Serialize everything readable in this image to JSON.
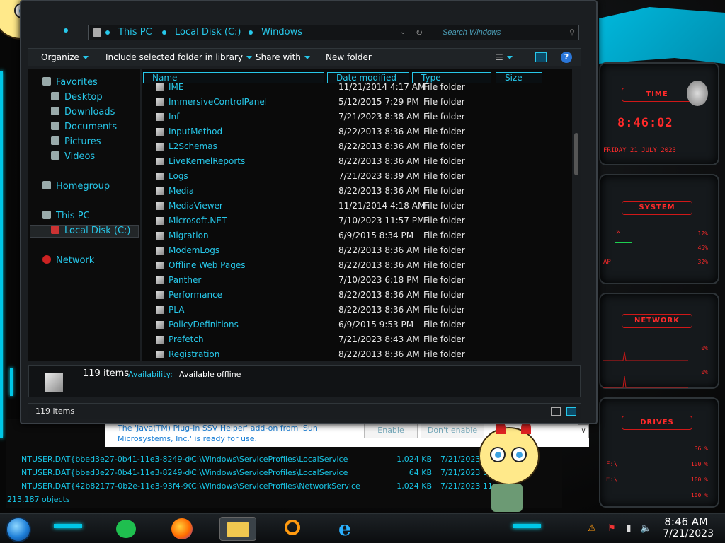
{
  "explorer": {
    "breadcrumb": [
      "This PC",
      "Local Disk (C:)",
      "Windows"
    ],
    "search_placeholder": "Search Windows",
    "toolbar": {
      "organize": "Organize",
      "include": "Include selected folder in library",
      "share": "Share with",
      "new_folder": "New folder"
    },
    "nav": {
      "favorites": "Favorites",
      "desktop": "Desktop",
      "downloads": "Downloads",
      "documents": "Documents",
      "pictures": "Pictures",
      "videos": "Videos",
      "homegroup": "Homegroup",
      "this_pc": "This PC",
      "local_disk": "Local Disk (C:)",
      "network": "Network"
    },
    "columns": {
      "name": "Name",
      "date": "Date modified",
      "type": "Type",
      "size": "Size"
    },
    "files": [
      {
        "name": "IME",
        "date": "11/21/2014 4:17 AM",
        "type": "File folder"
      },
      {
        "name": "ImmersiveControlPanel",
        "date": "5/12/2015 7:29 PM",
        "type": "File folder"
      },
      {
        "name": "Inf",
        "date": "7/21/2023 8:38 AM",
        "type": "File folder"
      },
      {
        "name": "InputMethod",
        "date": "8/22/2013 8:36 AM",
        "type": "File folder"
      },
      {
        "name": "L2Schemas",
        "date": "8/22/2013 8:36 AM",
        "type": "File folder"
      },
      {
        "name": "LiveKernelReports",
        "date": "8/22/2013 8:36 AM",
        "type": "File folder"
      },
      {
        "name": "Logs",
        "date": "7/21/2023 8:39 AM",
        "type": "File folder"
      },
      {
        "name": "Media",
        "date": "8/22/2013 8:36 AM",
        "type": "File folder"
      },
      {
        "name": "MediaViewer",
        "date": "11/21/2014 4:18 AM",
        "type": "File folder"
      },
      {
        "name": "Microsoft.NET",
        "date": "7/10/2023 11:57 PM",
        "type": "File folder"
      },
      {
        "name": "Migration",
        "date": "6/9/2015 8:34 PM",
        "type": "File folder"
      },
      {
        "name": "ModemLogs",
        "date": "8/22/2013 8:36 AM",
        "type": "File folder"
      },
      {
        "name": "Offline Web Pages",
        "date": "8/22/2013 8:36 AM",
        "type": "File folder"
      },
      {
        "name": "Panther",
        "date": "7/10/2023 6:18 PM",
        "type": "File folder"
      },
      {
        "name": "Performance",
        "date": "8/22/2013 8:36 AM",
        "type": "File folder"
      },
      {
        "name": "PLA",
        "date": "8/22/2013 8:36 AM",
        "type": "File folder"
      },
      {
        "name": "PolicyDefinitions",
        "date": "6/9/2015 9:53 PM",
        "type": "File folder"
      },
      {
        "name": "Prefetch",
        "date": "7/21/2023 8:43 AM",
        "type": "File folder"
      },
      {
        "name": "Registration",
        "date": "8/22/2013 8:36 AM",
        "type": "File folder"
      }
    ],
    "details": {
      "count": "119 items",
      "availability_label": "Availability:",
      "availability_value": "Available offline"
    },
    "status": "119 items"
  },
  "notification": {
    "line1": "The 'Java(TM) Plug-In SSV Helper' add-on from 'Sun",
    "line2": "Microsystems, Inc.' is ready for use.",
    "enable": "Enable",
    "dont_enable": "Don't enable"
  },
  "background_list": {
    "rows": [
      {
        "name": "NTUSER.DAT{bbed3e27-0b41-11e3-8249-d6...",
        "path": "C:\\Windows\\ServiceProfiles\\LocalService",
        "size": "1,024 KB",
        "date": "7/21/2023 11:"
      },
      {
        "name": "NTUSER.DAT{bbed3e27-0b41-11e3-8249-d6...",
        "path": "C:\\Windows\\ServiceProfiles\\LocalService",
        "size": "64 KB",
        "date": "7/21/2023 11:"
      },
      {
        "name": "NTUSER.DAT{42b82177-0b2e-11e3-93f4-90b...",
        "path": "C:\\Windows\\ServiceProfiles\\NetworkService",
        "size": "1,024 KB",
        "date": "7/21/2023 11:"
      }
    ],
    "count": "213,187 objects"
  },
  "gadgets": {
    "time_title": "TIME",
    "time_value": "8:46:02",
    "date_value": "FRIDAY 21 JULY 2023",
    "system_title": "SYSTEM",
    "system_vals": [
      "12%",
      "45%",
      "32%"
    ],
    "system_label": "AP",
    "network_title": "NETWORK",
    "network_vals": [
      "0%",
      "0%"
    ],
    "drives_title": "DRIVES",
    "drives_vals": [
      "36 %",
      "100 %",
      "100 %",
      "100 %"
    ],
    "drives_labels": [
      "F:\\",
      "E:\\"
    ]
  },
  "taskbar": {
    "time": "8:46 AM",
    "date": "7/21/2023"
  },
  "colors": {
    "accent": "#27c8ea",
    "gadget_red": "#ff2a2a",
    "background": "#050505"
  }
}
